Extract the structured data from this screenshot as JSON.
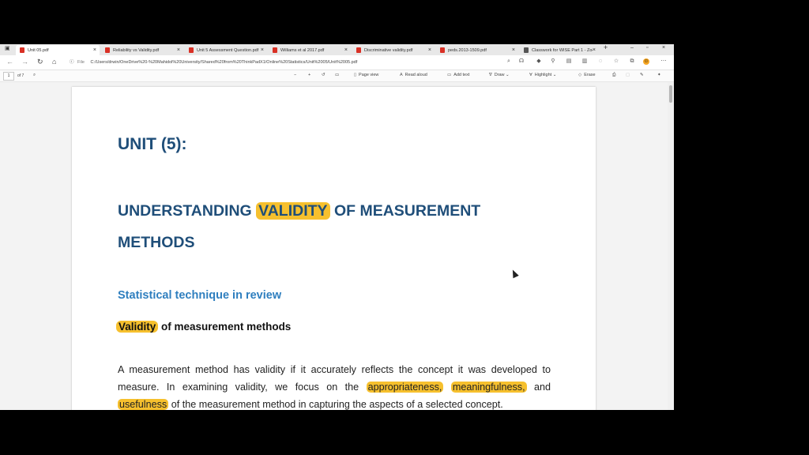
{
  "tabs": [
    {
      "label": "Unit 05.pdf",
      "icon": "pdf-icon",
      "active": true
    },
    {
      "label": "Reliability vs Validity.pdf",
      "icon": "pdf-icon"
    },
    {
      "label": "Unit 5 Assessment Question.pdf",
      "icon": "pdf-icon"
    },
    {
      "label": "Williams et al 2017.pdf",
      "icon": "pdf-icon"
    },
    {
      "label": "Discriminative validity.pdf",
      "icon": "pdf-icon"
    },
    {
      "label": "peds.2013-1509.pdf",
      "icon": "pdf-icon"
    },
    {
      "label": "Classwork for WISE Part 1 - Zoo",
      "icon": "zoom-icon"
    }
  ],
  "address": {
    "scheme_label": "File",
    "url": "C:/Users/drwin/OneDrive%20-%20Mahidol%20University/Shared%20from%20ThinkPadX1/Online%20Statistics/Unit%2005/Unit%2005.pdf"
  },
  "pdf_toolbar": {
    "page_number": "1",
    "page_count": "of 7",
    "page_view": "Page view",
    "read_aloud": "Read aloud",
    "add_text": "Add text",
    "draw": "Draw",
    "highlight": "Highlight",
    "erase": "Erase"
  },
  "document": {
    "unit_heading": "UNIT (5):",
    "title_part1": "UNDERSTANDING",
    "title_highlight": "VALIDITY",
    "title_part2": "OF MEASUREMENT METHODS",
    "section_heading": "Statistical technique in review",
    "validity_highlight": "Validity",
    "validity_rest": " of measurement methods",
    "para_1": "A measurement method has validity if it accurately reflects the concept it was developed to measure. In examining validity, we focus on the ",
    "hl_1": "appropriateness,",
    "hl_2": "meaningfulness,",
    "para_2": " and ",
    "hl_3": "usefulness",
    "para_3": " of the measurement method in capturing the aspects of a selected concept."
  },
  "colors": {
    "heading": "#1f4e79",
    "subheading": "#2f7fbf",
    "highlight": "#f6c02e"
  }
}
